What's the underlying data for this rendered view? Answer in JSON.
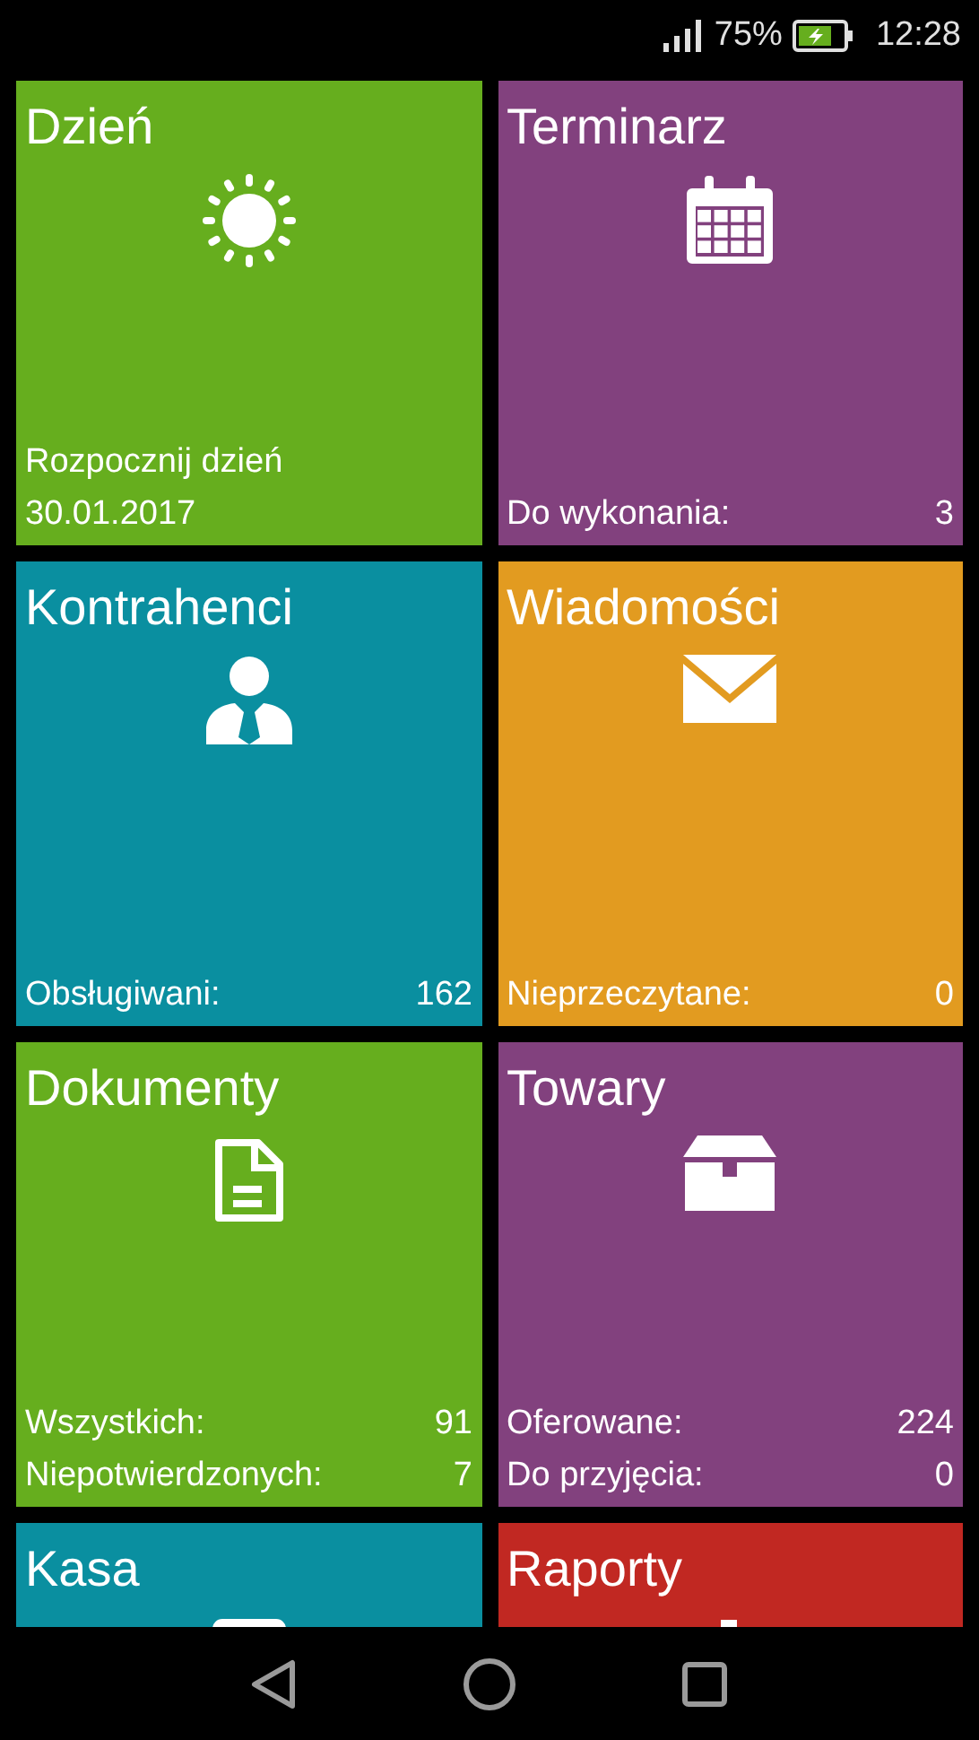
{
  "status_bar": {
    "battery": "75%",
    "time": "12:28"
  },
  "tiles": [
    {
      "title": "Dzień",
      "kind": "sun",
      "color": "#66ae1e",
      "lines": [
        {
          "label": "Rozpocznij dzień"
        },
        {
          "label": "30.01.2017"
        }
      ]
    },
    {
      "title": "Terminarz",
      "kind": "calendar",
      "color": "#82417e",
      "lines": [
        {
          "label": "Do wykonania:",
          "value": "3"
        }
      ]
    },
    {
      "title": "Kontrahenci",
      "kind": "person",
      "color": "#0a8fa0",
      "lines": [
        {
          "label": "Obsługiwani:",
          "value": "162"
        }
      ]
    },
    {
      "title": "Wiadomości",
      "kind": "envelope",
      "color": "#e29b20",
      "lines": [
        {
          "label": "Nieprzeczytane:",
          "value": "0"
        }
      ]
    },
    {
      "title": "Dokumenty",
      "kind": "document",
      "color": "#66ae1e",
      "lines": [
        {
          "label": "Wszystkich:",
          "value": "91"
        },
        {
          "label": "Niepotwierdzonych:",
          "value": "7"
        }
      ]
    },
    {
      "title": "Towary",
      "kind": "box",
      "color": "#82417e",
      "lines": [
        {
          "label": "Oferowane:",
          "value": "224"
        },
        {
          "label": "Do przyjęcia:",
          "value": "0"
        }
      ]
    },
    {
      "title": "Kasa",
      "kind": "register",
      "color": "#0a8fa0"
    },
    {
      "title": "Raporty",
      "kind": "chart",
      "color": "#c12822"
    }
  ]
}
